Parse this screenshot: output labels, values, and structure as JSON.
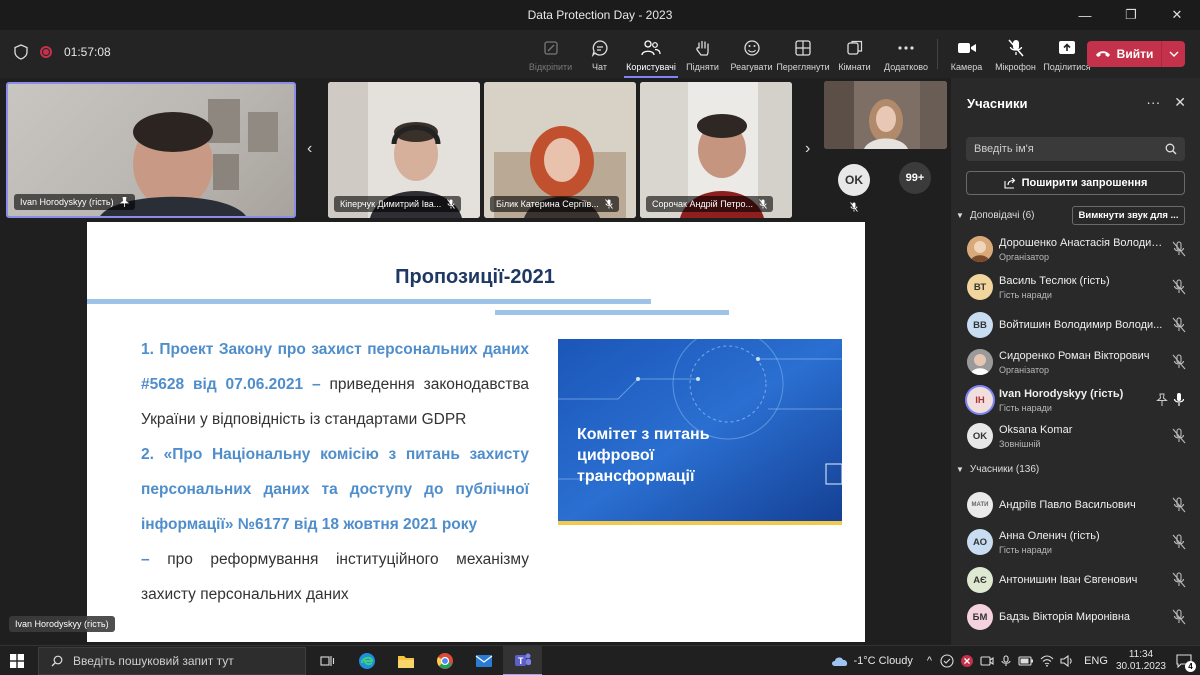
{
  "window": {
    "title": "Data Protection Day - 2023",
    "minimize": "—",
    "maximize": "❐",
    "close": "✕"
  },
  "meeting": {
    "timer": "01:57:08",
    "toolbar": [
      {
        "label": "Відкріпити"
      },
      {
        "label": "Чат"
      },
      {
        "label": "Користувачі"
      },
      {
        "label": "Підняти"
      },
      {
        "label": "Реагувати"
      },
      {
        "label": "Переглянути"
      },
      {
        "label": "Кімнати"
      },
      {
        "label": "Додатково"
      },
      {
        "label": "Камера"
      },
      {
        "label": "Мікрофон"
      },
      {
        "label": "Поділитися"
      }
    ],
    "leave_label": "Вийти"
  },
  "videos": {
    "tiles": [
      {
        "name": "Ivan Horodyskyy (гість)"
      },
      {
        "name": "Кіперчук Димитрий Іва..."
      },
      {
        "name": "Білик Катерина Сергіїв..."
      },
      {
        "name": "Сорочак Андрій Петро..."
      }
    ],
    "extra_avatar": "OK",
    "more_count": "99+"
  },
  "slide": {
    "title": "Пропозиції-2021",
    "item1_bold": "1. Проект Закону про захист персональних даних #5628 від 07.06.2021 –",
    "item1_rest": " приведення законодавства України у відповідність із стандартами GDPR",
    "item2_bold": "2. «Про Національну комісію з питань захисту персональних даних та доступу до публічної інформації» №6177 від 18 жовтня 2021 року",
    "item2_dash": " –",
    "item2_rest": " про реформування інституційного механізму захисту персональних даних",
    "banner_line1": "Комітет з питань",
    "banner_line2": "цифрової",
    "banner_line3": "трансформації"
  },
  "self_view": {
    "name": "Ivan Horodyskyy (гість)"
  },
  "panel": {
    "title": "Учасники",
    "search_placeholder": "Введіть ім'я",
    "share_label": "Поширити запрошення",
    "presenters_label": "Доповідачі (6)",
    "mute_all_label": "Вимкнути звук для ...",
    "presenters": [
      {
        "initials": "",
        "name": "Дорошенко Анастасія Володим...",
        "role": "Організатор"
      },
      {
        "initials": "ВТ",
        "name": "Василь Теслюк (гість)",
        "role": "Гість наради"
      },
      {
        "initials": "ВВ",
        "name": "Войтишин Володимир Володи...",
        "role": ""
      },
      {
        "initials": "",
        "name": "Сидоренко Роман Вікторович",
        "role": "Організатор"
      },
      {
        "initials": "IH",
        "name": "Ivan Horodyskyy (гість)",
        "role": "Гість наради"
      },
      {
        "initials": "OK",
        "name": "Oksana Komar",
        "role": "Зовнішній"
      }
    ],
    "attendees_label": "Учасники (136)",
    "attendees": [
      {
        "initials": "МАТИ",
        "name": "Андріїв Павло Васильович",
        "role": ""
      },
      {
        "initials": "АО",
        "name": "Анна Оленич (гість)",
        "role": "Гість наради"
      },
      {
        "initials": "АЄ",
        "name": "Антонишин Іван Євгенович",
        "role": ""
      },
      {
        "initials": "БМ",
        "name": "Бадзь Вікторія Миронівна",
        "role": ""
      }
    ]
  },
  "taskbar": {
    "search_placeholder": "Введіть пошуковий запит тут",
    "weather": "-1°C  Cloudy",
    "language": "ENG",
    "time": "11:34",
    "date": "30.01.2023",
    "notifications": "4"
  }
}
